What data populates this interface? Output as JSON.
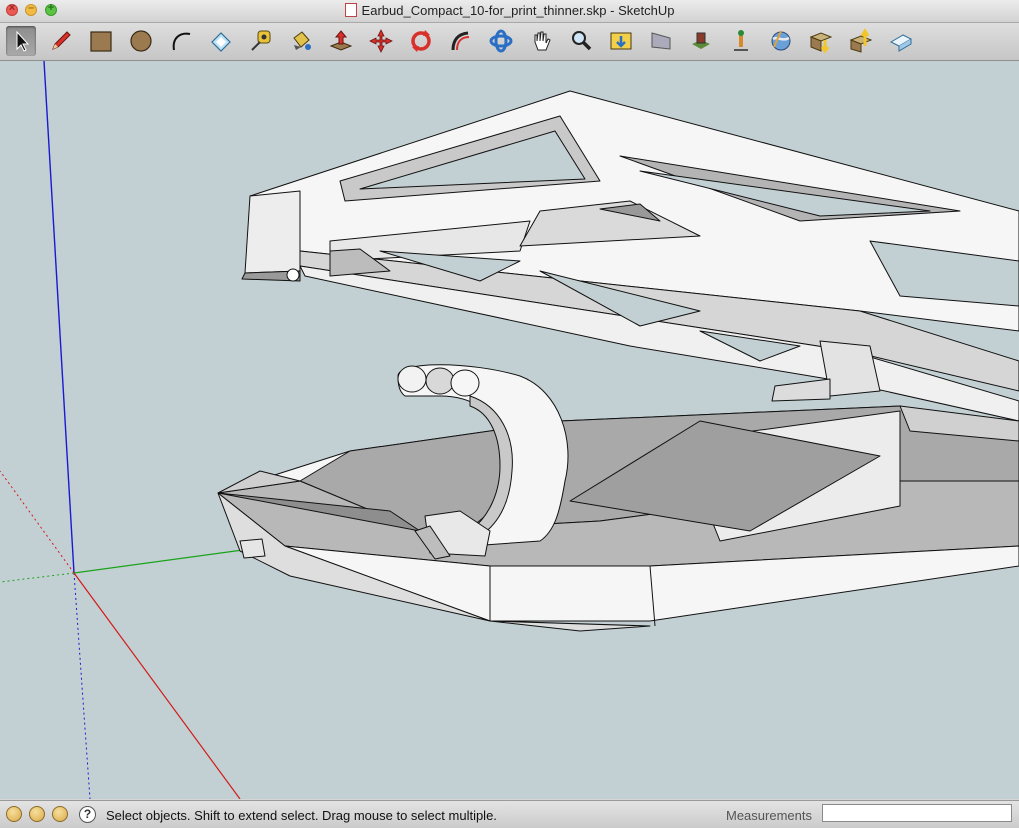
{
  "window": {
    "title": "Earbud_Compact_10-for_print_thinner.skp - SketchUp"
  },
  "toolbar": {
    "tools": [
      {
        "name": "select-tool",
        "icon": "arrow-cursor-icon"
      },
      {
        "name": "pencil-tool",
        "icon": "pencil-icon"
      },
      {
        "name": "rectangle-tool",
        "icon": "rectangle-icon"
      },
      {
        "name": "circle-tool",
        "icon": "circle-icon"
      },
      {
        "name": "arc-tool",
        "icon": "arc-icon"
      },
      {
        "name": "eraser-tool",
        "icon": "eraser-icon"
      },
      {
        "name": "tape-measure-tool",
        "icon": "tape-measure-icon"
      },
      {
        "name": "paint-bucket-tool",
        "icon": "paint-bucket-icon"
      },
      {
        "name": "push-pull-tool",
        "icon": "push-pull-icon"
      },
      {
        "name": "move-tool",
        "icon": "move-icon"
      },
      {
        "name": "rotate-tool",
        "icon": "rotate-icon"
      },
      {
        "name": "follow-me-tool",
        "icon": "follow-me-icon"
      },
      {
        "name": "orbit-tool",
        "icon": "orbit-icon"
      },
      {
        "name": "pan-tool",
        "icon": "hand-icon"
      },
      {
        "name": "zoom-tool",
        "icon": "magnifier-icon"
      },
      {
        "name": "zoom-extents-tool",
        "icon": "zoom-extents-icon"
      },
      {
        "name": "previous-view-tool",
        "icon": "previous-view-icon"
      },
      {
        "name": "get-models-tool",
        "icon": "get-models-icon"
      },
      {
        "name": "add-location-tool",
        "icon": "add-location-icon"
      },
      {
        "name": "toggle-terrain-tool",
        "icon": "globe-icon"
      },
      {
        "name": "get-models-share-tool",
        "icon": "download-box-icon"
      },
      {
        "name": "share-model-tool",
        "icon": "upload-box-icon"
      },
      {
        "name": "layout-tool",
        "icon": "layout-icon"
      }
    ],
    "active_tool": "select-tool"
  },
  "status": {
    "hint": "Select objects. Shift to extend select. Drag mouse to select multiple.",
    "help_symbol": "?",
    "measurements_label": "Measurements",
    "measurements_value": ""
  },
  "colors": {
    "viewport_bg": "#c3d0d3",
    "axis_red": "#d11a1a",
    "axis_green": "#1aa31a",
    "axis_blue": "#1a1ad1",
    "model_face": "#f6f6f6",
    "model_shadow": "#a6a6a6"
  }
}
